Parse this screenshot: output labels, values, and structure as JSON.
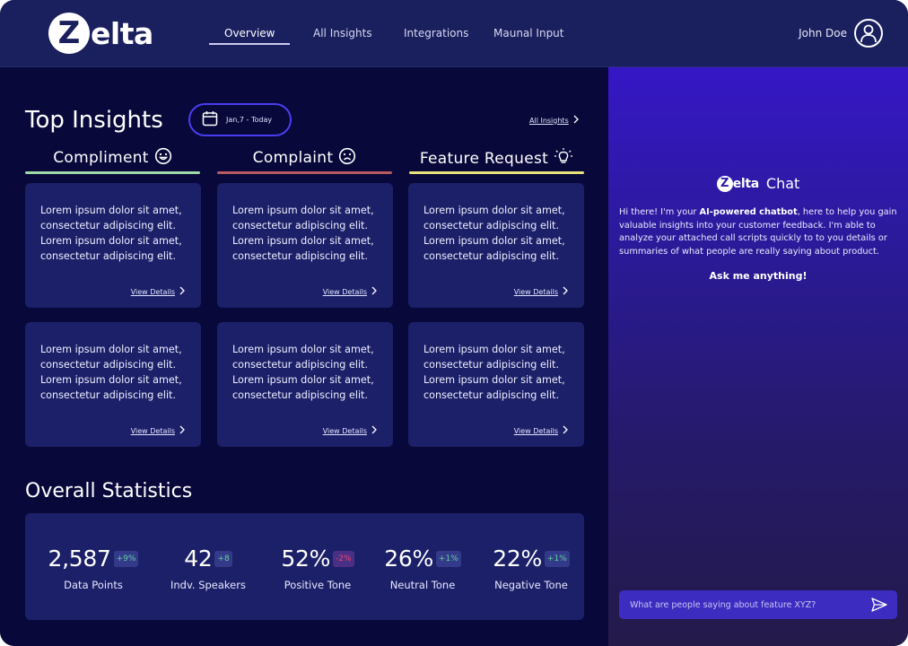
{
  "brand": {
    "logo_letter": "Z",
    "logo_rest": "elta"
  },
  "nav": {
    "items": [
      {
        "label": "Overview",
        "active": true
      },
      {
        "label": "All Insights"
      },
      {
        "label": "Integrations"
      },
      {
        "label": "Maunal Input"
      }
    ]
  },
  "user": {
    "name": "John Doe",
    "icon": "user-circle-icon"
  },
  "insights": {
    "title": "Top Insights",
    "date_range": "Jan,7 - Today",
    "all_link": "All Insights",
    "columns": [
      {
        "label": "Compliment",
        "icon": "smile-icon",
        "color": "#9fd9a8"
      },
      {
        "label": "Complaint",
        "icon": "frown-icon",
        "color": "#b85a5f"
      },
      {
        "label": "Feature Request",
        "icon": "lightbulb-icon",
        "color": "#e8e27a"
      }
    ],
    "cards": [
      {
        "text": "Lorem ipsum dolor sit amet, consectetur adipiscing elit. Lorem ipsum dolor sit amet, consectetur adipiscing elit.",
        "link": "View Details"
      },
      {
        "text": "Lorem ipsum dolor sit amet, consectetur adipiscing elit. Lorem ipsum dolor sit amet, consectetur adipiscing elit.",
        "link": "View Details"
      },
      {
        "text": "Lorem ipsum dolor sit amet, consectetur adipiscing elit. Lorem ipsum dolor sit amet, consectetur adipiscing elit.",
        "link": "View Details"
      },
      {
        "text": "Lorem ipsum dolor sit amet, consectetur adipiscing elit. Lorem ipsum dolor sit amet, consectetur adipiscing elit.",
        "link": "View Details"
      },
      {
        "text": "Lorem ipsum dolor sit amet, consectetur adipiscing elit. Lorem ipsum dolor sit amet, consectetur adipiscing elit.",
        "link": "View Details"
      },
      {
        "text": "Lorem ipsum dolor sit amet, consectetur adipiscing elit. Lorem ipsum dolor sit amet, consectetur adipiscing elit.",
        "link": "View Details"
      }
    ]
  },
  "stats": {
    "title": "Overall Statistics",
    "items": [
      {
        "value": "2,587",
        "delta": "+9%",
        "trend": "up",
        "label": "Data Points"
      },
      {
        "value": "42",
        "delta": "+8",
        "trend": "up",
        "label": "Indv. Speakers"
      },
      {
        "value": "52%",
        "delta": "-2%",
        "trend": "down",
        "label": "Positive Tone"
      },
      {
        "value": "26%",
        "delta": "+1%",
        "trend": "up",
        "label": "Neutral Tone"
      },
      {
        "value": "22%",
        "delta": "+1%",
        "trend": "up",
        "label": "Negative Tone"
      }
    ]
  },
  "chat": {
    "logo_letter": "Z",
    "logo_rest": "elta",
    "title": "Chat",
    "intro_before": "Hi there! I'm your ",
    "intro_bold": "AI-powered chatbot",
    "intro_after": ", here to help you gain valuable insights into your customer feedback. I'm able to analyze your attached call scripts quickly to to you details or summaries of what people are really saying about product.",
    "ask": "Ask me anything!",
    "input_placeholder": "What are people saying about feature XYZ?",
    "send_icon": "send-icon"
  },
  "colors": {
    "accent": "#4a3df0",
    "card": "#1c2068",
    "header": "#1a1f5e",
    "background": "#08093a"
  }
}
